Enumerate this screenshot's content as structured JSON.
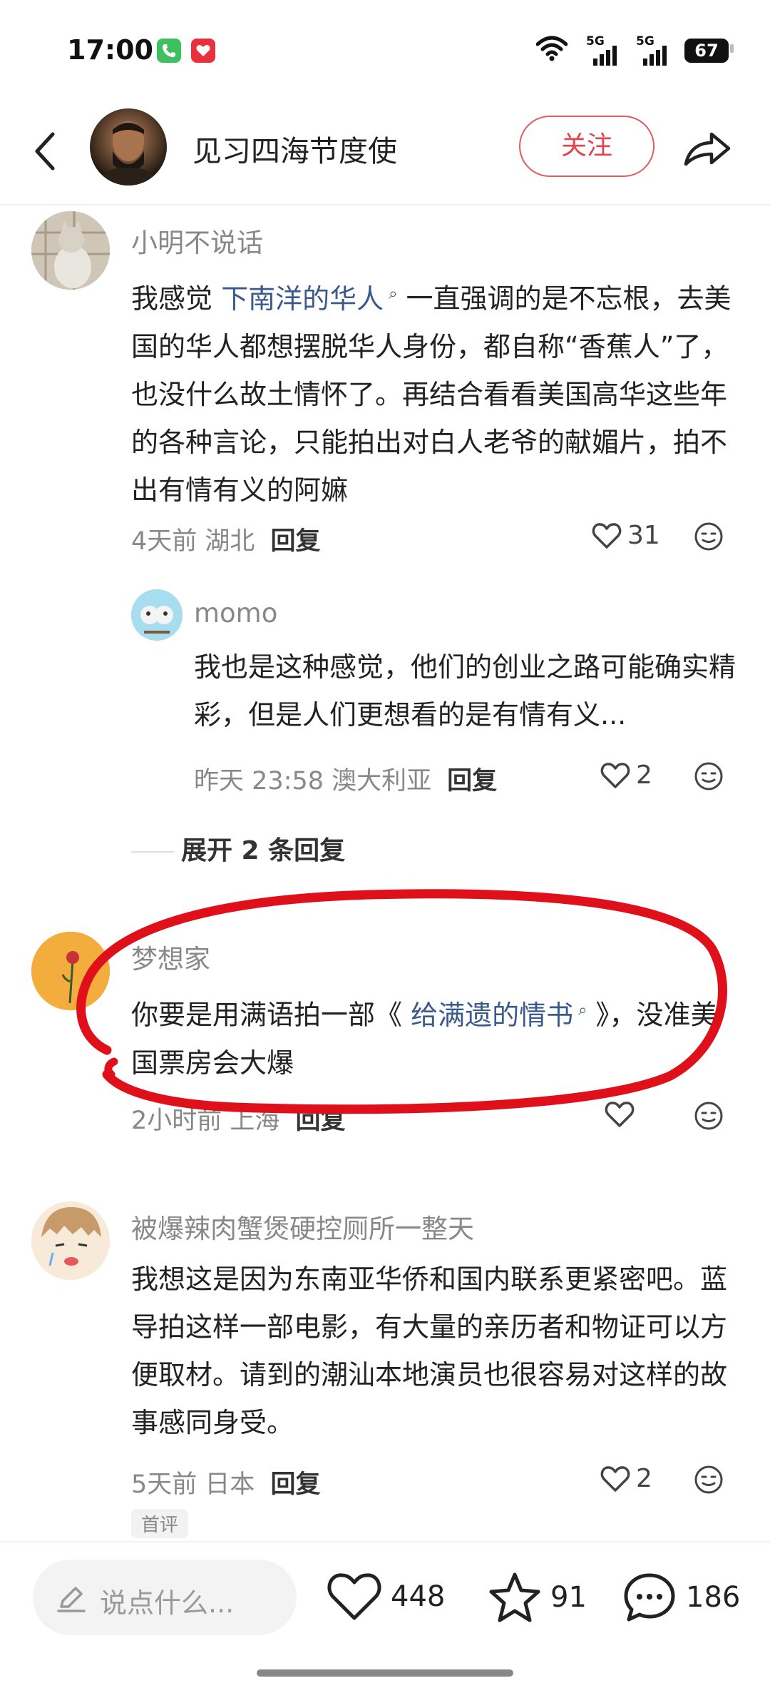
{
  "status_bar": {
    "time": "17:00",
    "signal1": "5G",
    "signal2": "5G",
    "battery": "67"
  },
  "header": {
    "title": "见习四海节度使",
    "follow_label": "关注"
  },
  "comments": [
    {
      "user": "小明不说话",
      "body_pre": "我感觉 ",
      "link": "下南洋的华人",
      "body_post": " 一直强调的是不忘根，去美国的华人都想摆脱华人身份，都自称“香蕉人”了，也没什么故土情怀了。再结合看看美国高华这些年的各种言论，只能拍出对白人老爷的献媚片，拍不出有情有义的阿嫲",
      "time": "4天前",
      "location": "湖北",
      "reply_label": "回复",
      "likes": "31"
    },
    {
      "user": "梦想家",
      "body_pre": "你要是用满语拍一部《 ",
      "link": "给满遗的情书",
      "body_post": " 》，没准美国票房会大爆",
      "time": "2小时前",
      "location": "上海",
      "reply_label": "回复",
      "likes": ""
    },
    {
      "user": "被爆辣肉蟹煲硬控厕所一整天",
      "body": "我想这是因为东南亚华侨和国内联系更紧密吧。蓝导拍这样一部电影，有大量的亲历者和物证可以方便取材。请到的潮汕本地演员也很容易对这样的故事感同身受。",
      "time": "5天前",
      "location": "日本",
      "reply_label": "回复",
      "likes": "2",
      "badge": "首评"
    }
  ],
  "sub_reply": {
    "user": "momo",
    "body": "我也是这种感觉，他们的创业之路可能确实精彩，但是人们更想看的是有情有义...",
    "time": "昨天 23:58",
    "location": "澳大利亚",
    "reply_label": "回复",
    "likes": "2"
  },
  "expand_label": "展开 2 条回复",
  "bottom_bar": {
    "input_placeholder": "说点什么...",
    "likes": "448",
    "favorites": "91",
    "comments": "186"
  },
  "colors": {
    "accent": "#e0444e",
    "link": "#3a5a8c",
    "annotation": "#e0101a"
  }
}
